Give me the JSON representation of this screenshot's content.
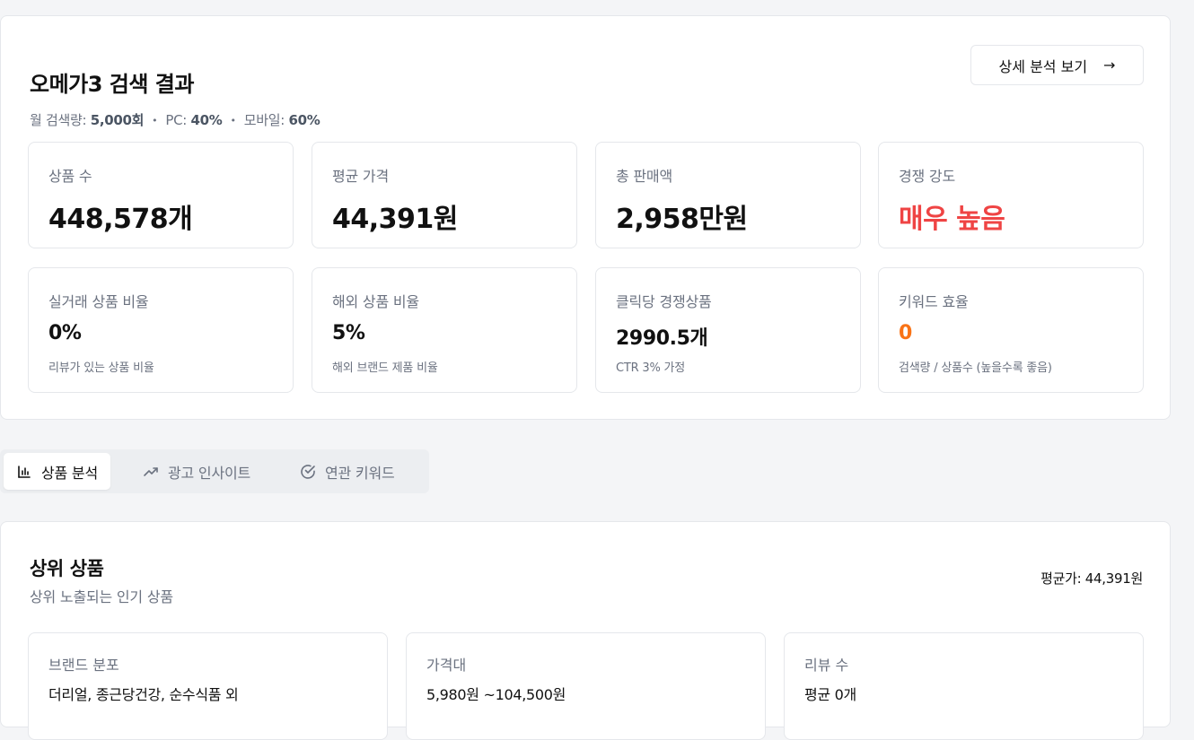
{
  "summary": {
    "title": "오메가3 검색 결과",
    "search_volume_label": "월 검색량: ",
    "search_volume": "5,000회",
    "pc_label": "PC: ",
    "pc_value": "40%",
    "mobile_label": "모바일: ",
    "mobile_value": "60%",
    "dot": "•",
    "detail_button": "상세 분석 보기",
    "detail_arrow": "→"
  },
  "stats": [
    {
      "label": "상품 수",
      "value": "448,578개"
    },
    {
      "label": "평균 가격",
      "value": "44,391원"
    },
    {
      "label": "총 판매액",
      "value": "2,958만원"
    },
    {
      "label": "경쟁 강도",
      "value": "매우 높음",
      "color": "#ef4444"
    }
  ],
  "stats2": [
    {
      "label": "실거래 상품 비율",
      "value": "0%",
      "note": "리뷰가 있는 상품 비율"
    },
    {
      "label": "해외 상품 비율",
      "value": "5%",
      "note": "해외 브랜드 제품 비율"
    },
    {
      "label": "클릭당 경쟁상품",
      "value": "2990.5개",
      "note": "CTR 3% 가정"
    },
    {
      "label": "키워드 효율",
      "value": "0",
      "note": "검색량 / 상품수 (높을수록 좋음)",
      "color": "#f97316"
    }
  ],
  "tabs": [
    {
      "label": "상품 분석",
      "icon": "bar-chart-icon",
      "active": true
    },
    {
      "label": "광고 인사이트",
      "icon": "trending-up-icon",
      "active": false
    },
    {
      "label": "연관 키워드",
      "icon": "check-circle-icon",
      "active": false
    }
  ],
  "top_products": {
    "title": "상위 상품",
    "subtitle": "상위 노출되는 인기 상품",
    "avg_price": "평균가: 44,391원",
    "cards": [
      {
        "label": "브랜드 분포",
        "value": "더리얼, 종근당건강, 순수식품 외"
      },
      {
        "label": "가격대",
        "value": "5,980원 ~104,500원"
      },
      {
        "label": "리뷰 수",
        "value": "평균 0개"
      }
    ]
  }
}
